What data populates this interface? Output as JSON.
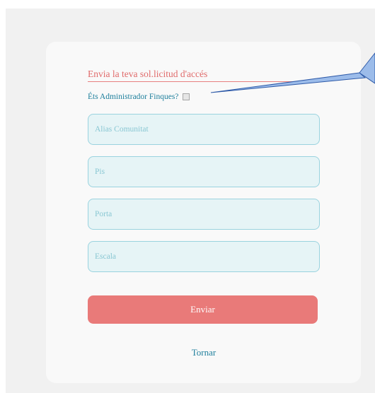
{
  "form": {
    "title": "Envia la teva sol.licitud d'accés",
    "admin_label": "Éts Administrador Finques?",
    "fields": [
      {
        "placeholder": "Alias Comunitat",
        "value": ""
      },
      {
        "placeholder": "Pis",
        "value": ""
      },
      {
        "placeholder": "Porta",
        "value": ""
      },
      {
        "placeholder": "Escala",
        "value": ""
      }
    ],
    "submit_label": "Enviar",
    "back_label": "Tornar"
  },
  "colors": {
    "accent": "#e97a79",
    "link": "#1e7f9c",
    "field_bg": "#e6f4f6",
    "field_border": "#9ad3df",
    "callout_fill": "#9cbcea"
  }
}
